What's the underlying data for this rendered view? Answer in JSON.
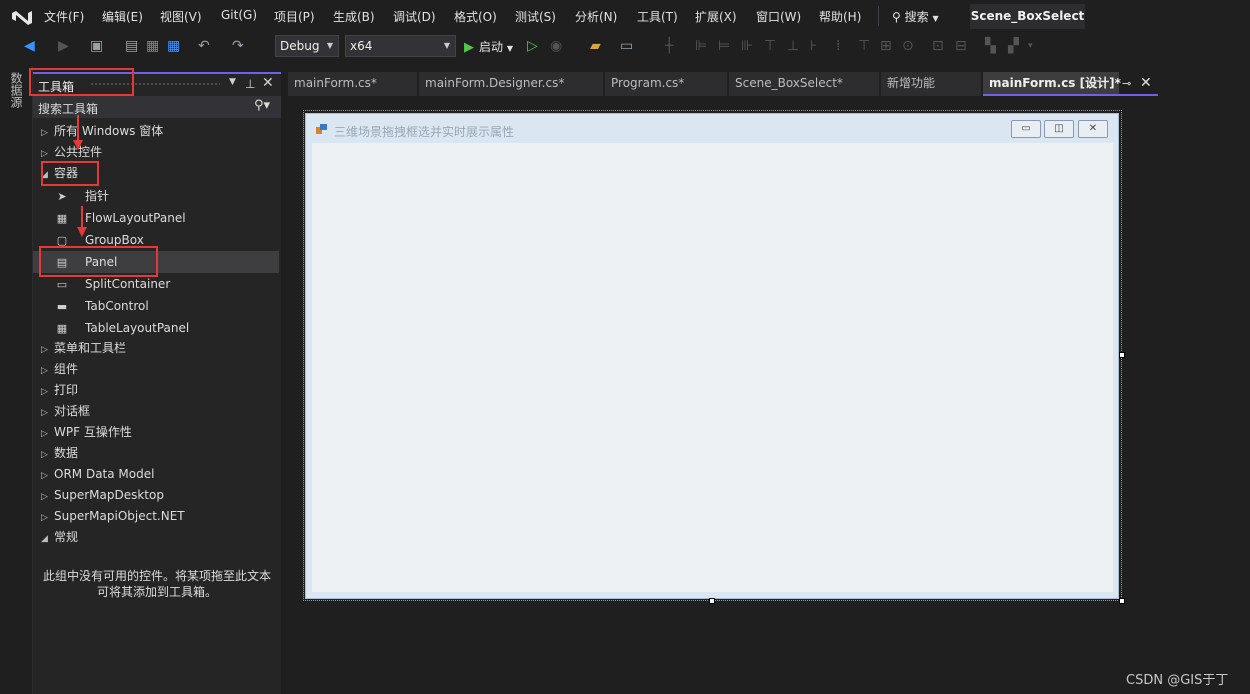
{
  "menu": {
    "items": [
      "文件(F)",
      "编辑(E)",
      "视图(V)",
      "Git(G)",
      "项目(P)",
      "生成(B)",
      "调试(D)",
      "格式(O)",
      "测试(S)",
      "分析(N)",
      "工具(T)",
      "扩展(X)",
      "窗口(W)",
      "帮助(H)"
    ],
    "search_label": "搜索",
    "solution_name": "Scene_BoxSelect"
  },
  "toolbar": {
    "config": "Debug",
    "platform": "x64",
    "start_label": "启动"
  },
  "left_strip": {
    "label": "数据源"
  },
  "toolbox": {
    "title": "工具箱",
    "search_placeholder": "搜索工具箱",
    "categories_top": [
      {
        "label": "所有 Windows 窗体",
        "expanded": false
      },
      {
        "label": "公共控件",
        "expanded": false
      },
      {
        "label": "容器",
        "expanded": true
      }
    ],
    "container_items": [
      {
        "label": "指针",
        "icon": "pointer-icon"
      },
      {
        "label": "FlowLayoutPanel",
        "icon": "flowlayoutpanel-icon"
      },
      {
        "label": "GroupBox",
        "icon": "groupbox-icon"
      },
      {
        "label": "Panel",
        "icon": "panel-icon",
        "selected": true
      },
      {
        "label": "SplitContainer",
        "icon": "splitcontainer-icon"
      },
      {
        "label": "TabControl",
        "icon": "tabcontrol-icon"
      },
      {
        "label": "TableLayoutPanel",
        "icon": "tablelayoutpanel-icon"
      }
    ],
    "categories_bottom": [
      {
        "label": "菜单和工具栏",
        "expanded": false
      },
      {
        "label": "组件",
        "expanded": false
      },
      {
        "label": "打印",
        "expanded": false
      },
      {
        "label": "对话框",
        "expanded": false
      },
      {
        "label": "WPF 互操作性",
        "expanded": false
      },
      {
        "label": "数据",
        "expanded": false
      },
      {
        "label": "ORM Data Model",
        "expanded": false
      },
      {
        "label": "SuperMapDesktop",
        "expanded": false
      },
      {
        "label": "SuperMapiObject.NET",
        "expanded": false
      },
      {
        "label": "常规",
        "expanded": true
      }
    ],
    "empty_message": "此组中没有可用的控件。将某项拖至此文本可将其添加到工具箱。"
  },
  "tabs": [
    {
      "label": "mainForm.cs*",
      "active": false
    },
    {
      "label": "mainForm.Designer.cs*",
      "active": false
    },
    {
      "label": "Program.cs*",
      "active": false
    },
    {
      "label": "Scene_BoxSelect*",
      "active": false
    },
    {
      "label": "新增功能",
      "active": false
    },
    {
      "label": "mainForm.cs [设计]*",
      "active": true
    }
  ],
  "form": {
    "title": "三维场景拖拽框选并实时展示属性"
  },
  "watermark": "CSDN @GIS于丁",
  "colors": {
    "accent": "#7160e8",
    "highlight_box": "#e53935",
    "form_background": "#dae7f3",
    "start_green": "#4ec94e"
  }
}
